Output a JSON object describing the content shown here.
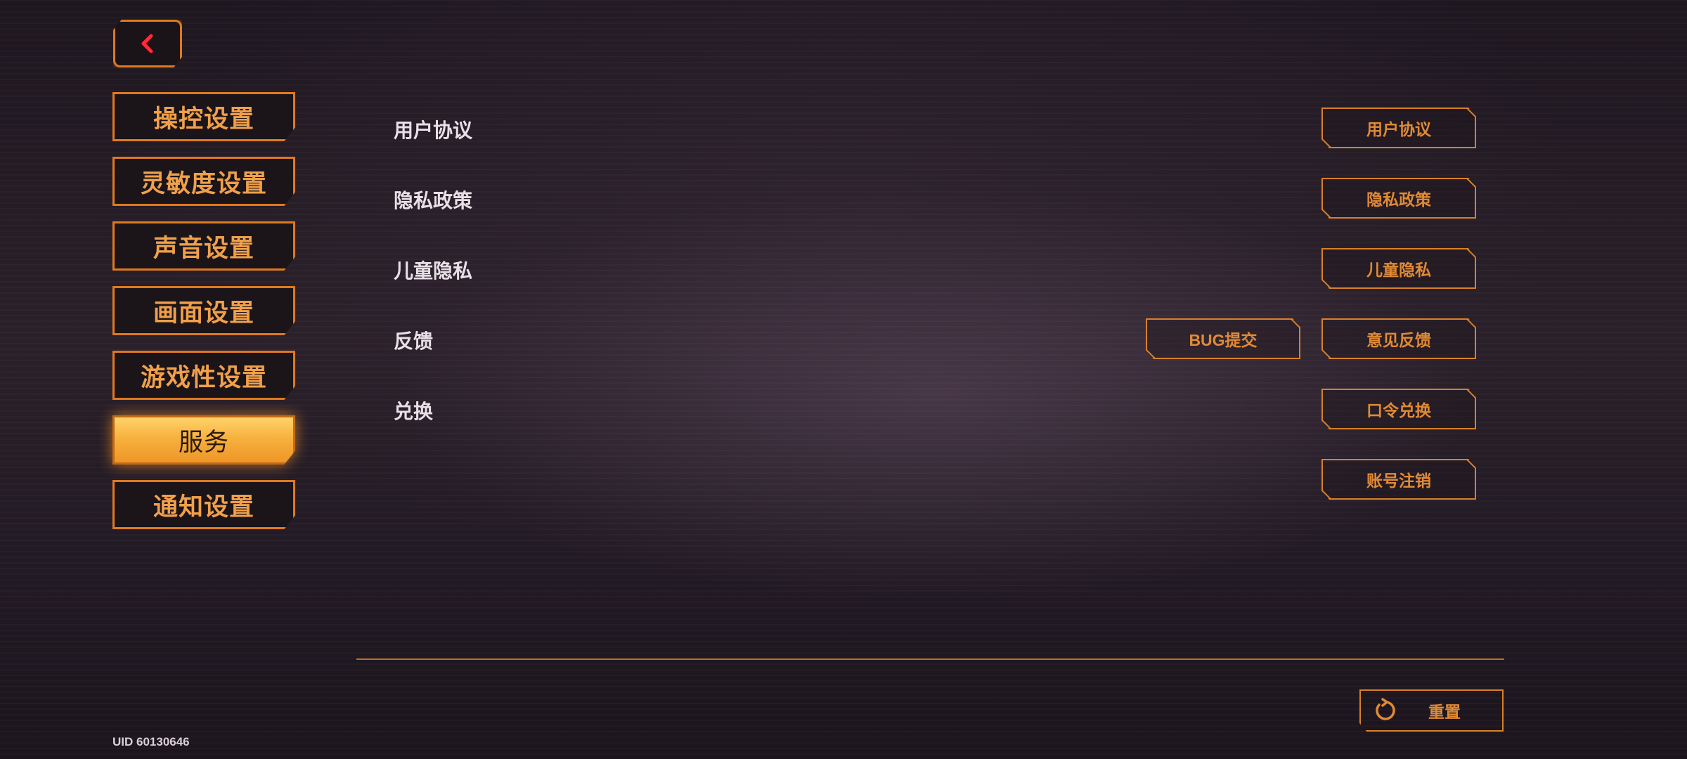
{
  "back": {
    "icon": "chevron-left-icon"
  },
  "sidebar": {
    "items": [
      {
        "label": "操控设置"
      },
      {
        "label": "灵敏度设置"
      },
      {
        "label": "声音设置"
      },
      {
        "label": "画面设置"
      },
      {
        "label": "游戏性设置"
      },
      {
        "label": "服务"
      },
      {
        "label": "通知设置"
      }
    ],
    "active_index": 5
  },
  "rows": [
    {
      "label": "用户协议"
    },
    {
      "label": "隐私政策"
    },
    {
      "label": "儿童隐私"
    },
    {
      "label": "反馈"
    },
    {
      "label": "兑换"
    }
  ],
  "buttons": {
    "user_agreement": "用户协议",
    "privacy_policy": "隐私政策",
    "child_privacy": "儿童隐私",
    "bug_submit": "BUG提交",
    "feedback": "意见反馈",
    "code_redeem": "口令兑换",
    "account_cancel": "账号注销"
  },
  "reset": {
    "label": "重置",
    "icon": "refresh-icon"
  },
  "uid": "UID 60130646",
  "colors": {
    "accent": "#e0791f",
    "accent_text": "#f0a04a",
    "active_fill": "#f7b13e",
    "background": "#221a24"
  }
}
